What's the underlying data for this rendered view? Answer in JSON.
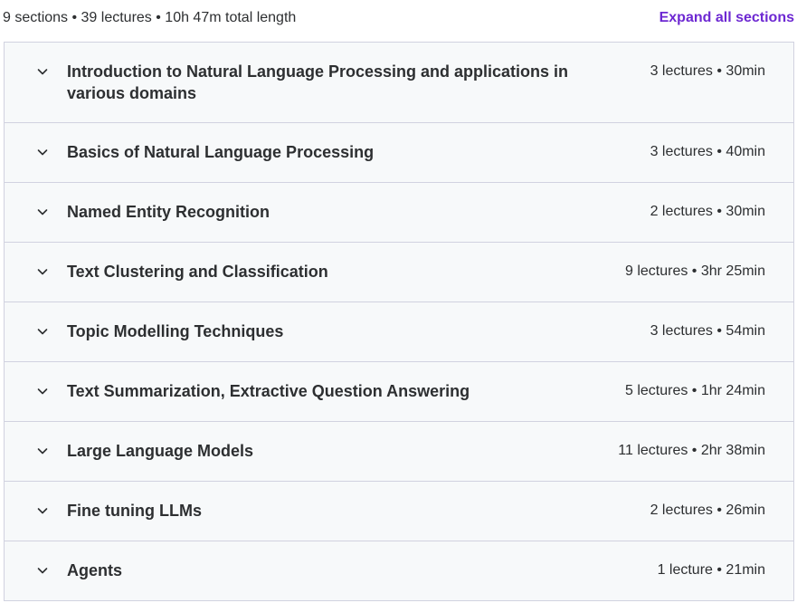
{
  "curriculum": {
    "summary": "9 sections • 39 lectures • 10h 47m total length",
    "expand_all_label": "Expand all sections",
    "accent_color": "#6d28d2",
    "sections": [
      {
        "title": "Introduction to Natural Language Processing and applications in various domains",
        "meta": "3 lectures • 30min",
        "icon": "chevron-down-icon"
      },
      {
        "title": "Basics of Natural Language Processing",
        "meta": "3 lectures • 40min",
        "icon": "chevron-down-icon"
      },
      {
        "title": "Named Entity Recognition",
        "meta": "2 lectures • 30min",
        "icon": "chevron-down-icon"
      },
      {
        "title": "Text Clustering and Classification",
        "meta": "9 lectures • 3hr 25min",
        "icon": "chevron-down-icon"
      },
      {
        "title": "Topic Modelling Techniques",
        "meta": "3 lectures • 54min",
        "icon": "chevron-down-icon"
      },
      {
        "title": "Text Summarization, Extractive Question Answering",
        "meta": "5 lectures • 1hr 24min",
        "icon": "chevron-down-icon"
      },
      {
        "title": "Large Language Models",
        "meta": "11 lectures • 2hr 38min",
        "icon": "chevron-down-icon"
      },
      {
        "title": "Fine tuning LLMs",
        "meta": "2 lectures • 26min",
        "icon": "chevron-down-icon"
      },
      {
        "title": "Agents",
        "meta": "1 lecture • 21min",
        "icon": "chevron-down-icon"
      }
    ]
  }
}
